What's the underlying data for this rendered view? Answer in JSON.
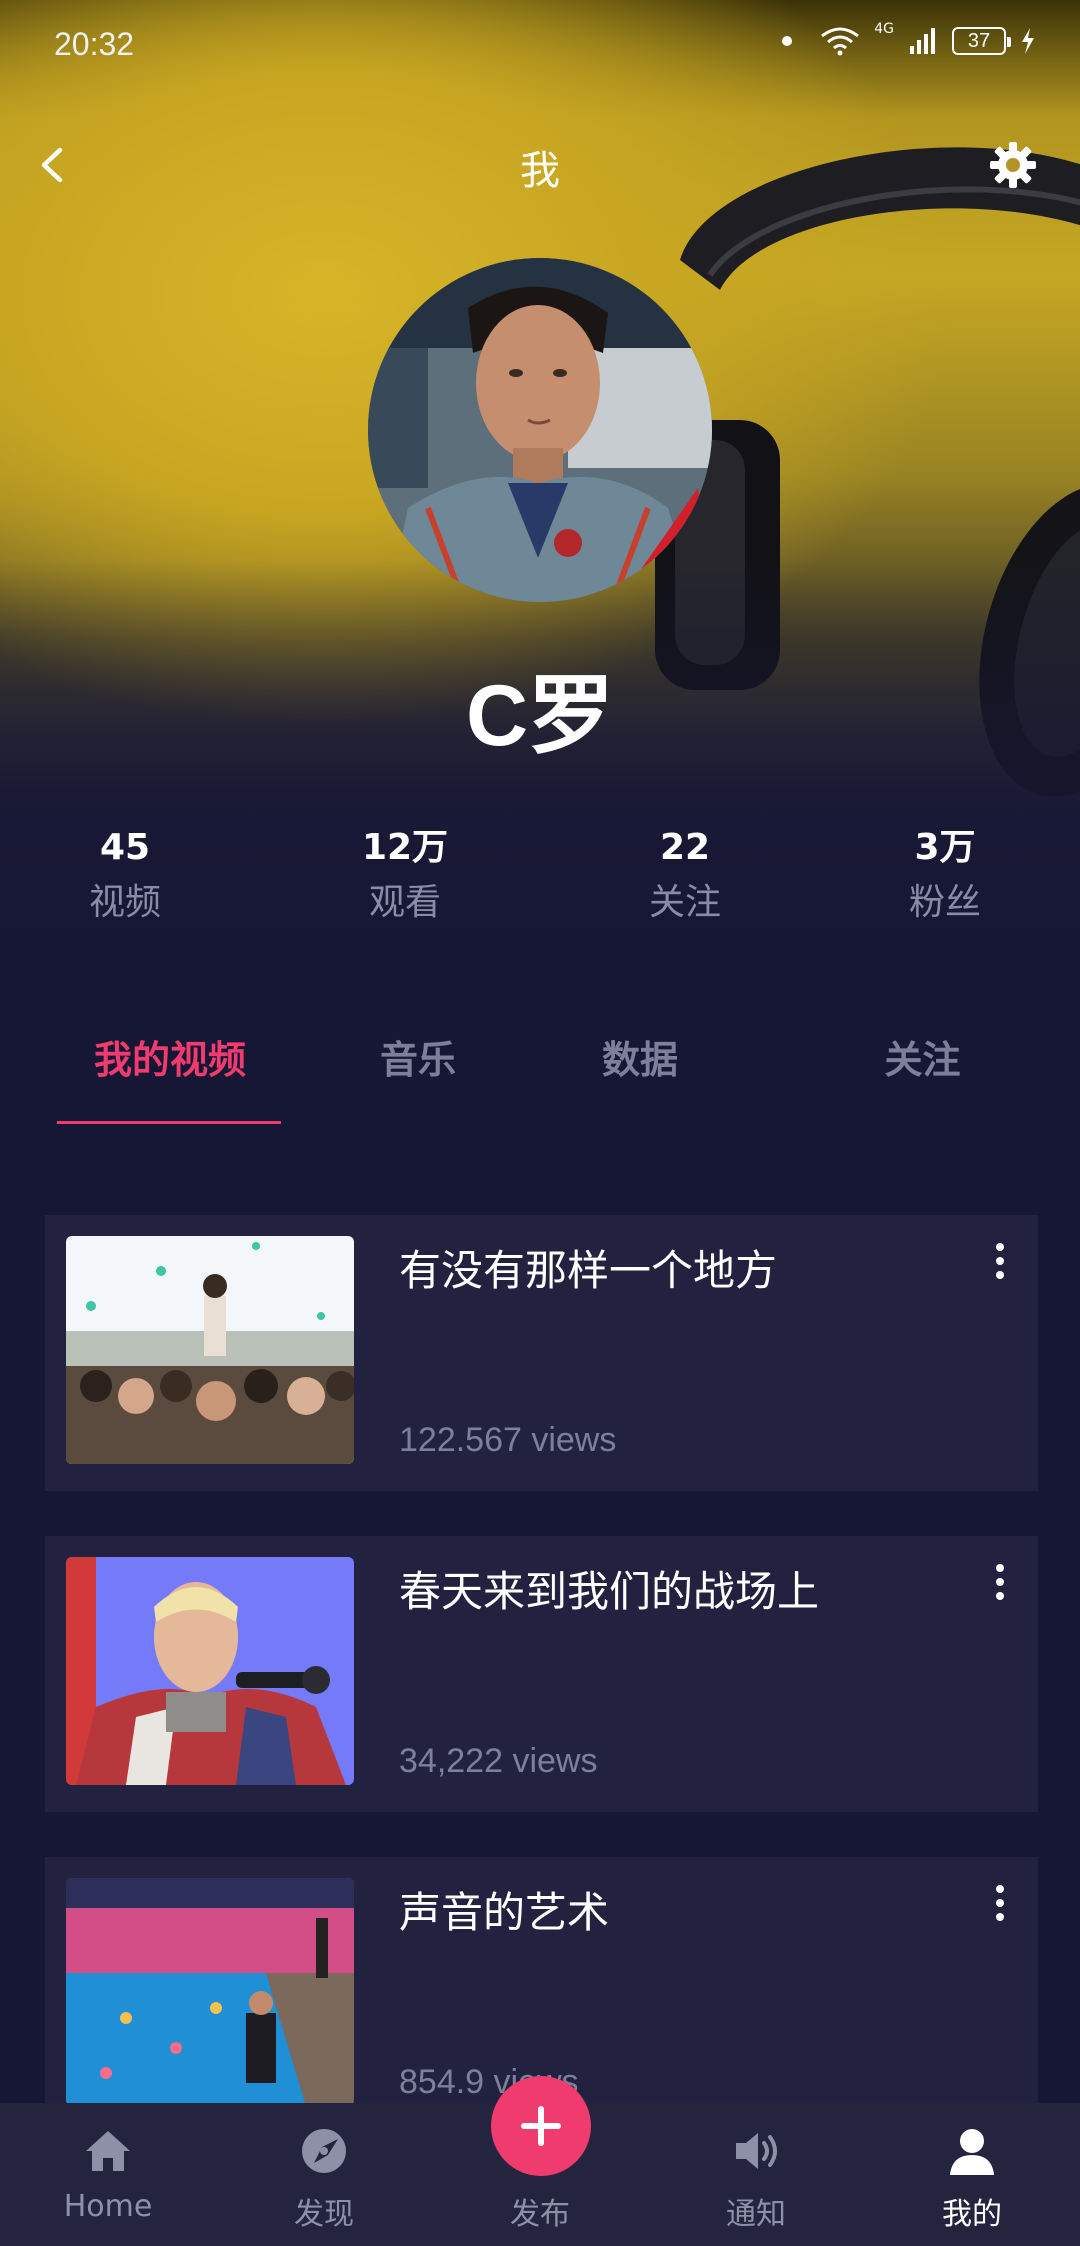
{
  "status_bar": {
    "time": "20:32",
    "network": "4G",
    "battery": "37"
  },
  "nav": {
    "title": "我",
    "back_icon": "chevron-left-icon",
    "settings_icon": "gear-icon"
  },
  "profile": {
    "name": "C罗"
  },
  "stats": [
    {
      "value": "45",
      "label": "视频"
    },
    {
      "value": "12万",
      "label": "观看"
    },
    {
      "value": "22",
      "label": "关注"
    },
    {
      "value": "3万",
      "label": "粉丝"
    }
  ],
  "tabs": [
    {
      "label": "我的视频",
      "active": true
    },
    {
      "label": "音乐",
      "active": false
    },
    {
      "label": "数据",
      "active": false
    },
    {
      "label": "关注",
      "active": false
    }
  ],
  "videos": [
    {
      "title": "有没有那样一个地方",
      "views": "122.567 views"
    },
    {
      "title": "春天来到我们的战场上",
      "views": "34,222 views"
    },
    {
      "title": "声音的艺术",
      "views": "854.9 views"
    }
  ],
  "bottom_nav": [
    {
      "label": "Home",
      "icon": "home-icon",
      "active": false
    },
    {
      "label": "发现",
      "icon": "compass-icon",
      "active": false
    },
    {
      "label": "发布",
      "icon": "plus-icon",
      "active": false
    },
    {
      "label": "通知",
      "icon": "speaker-icon",
      "active": false
    },
    {
      "label": "我的",
      "icon": "user-icon",
      "active": true
    }
  ],
  "colors": {
    "accent": "#ef3b6e",
    "background": "#161735",
    "card": "#222240",
    "muted_text": "#7d8098"
  }
}
